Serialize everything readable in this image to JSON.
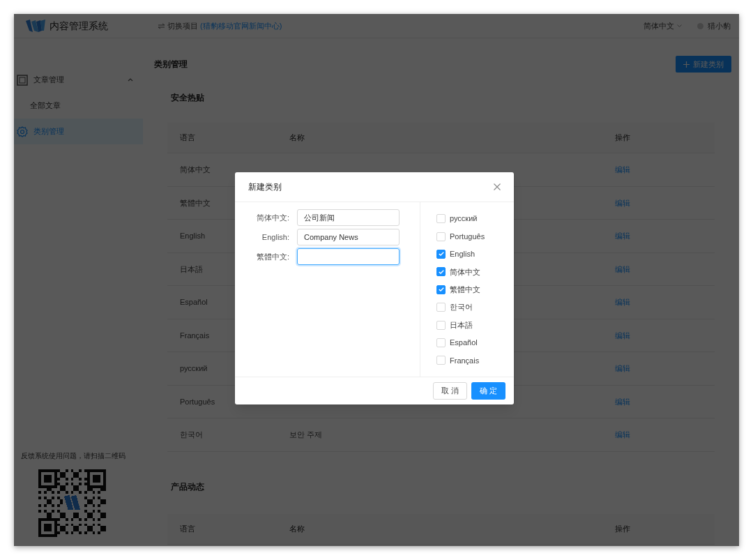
{
  "header": {
    "title": "内容管理系统",
    "switch_label": "切换项目",
    "project": "(猎豹移动官网新闻中心)",
    "language": "简体中文",
    "user": "猎小豹"
  },
  "sidebar": {
    "items": [
      {
        "label": "文章管理",
        "kind": "group",
        "selected": false,
        "expanded": true,
        "children": [
          {
            "label": "全部文章",
            "selected": false
          }
        ]
      },
      {
        "label": "类别管理",
        "kind": "link",
        "selected": true
      }
    ],
    "feedback": "反馈系统使用问题，请扫描二维码"
  },
  "page": {
    "title": "类别管理",
    "new_button": "新建类别"
  },
  "sections": [
    {
      "title": "安全热贴",
      "columns": [
        "语言",
        "名称",
        "操作"
      ],
      "rows": [
        {
          "language": "简体中文",
          "action": "编辑"
        },
        {
          "language": "繁體中文",
          "action": "编辑"
        },
        {
          "language": "English",
          "action": "编辑"
        },
        {
          "language": "日本語",
          "action": "编辑"
        },
        {
          "language": "Español",
          "action": "编辑"
        },
        {
          "language": "Français",
          "action": "编辑"
        },
        {
          "language": "русский",
          "action": "编辑"
        },
        {
          "language": "Português",
          "action": "编辑"
        },
        {
          "language": "한국어",
          "name": "보안 주제",
          "action": "编辑"
        }
      ]
    },
    {
      "title": "产品动态",
      "columns": [
        "语言",
        "名称",
        "操作"
      ]
    }
  ],
  "dialog": {
    "title": "新建类别",
    "fields": [
      {
        "label": "简体中文:",
        "value": "公司新闻",
        "focused": false
      },
      {
        "label": "English:",
        "value": "Company News",
        "focused": false
      },
      {
        "label": "繁體中文:",
        "focused": true
      }
    ],
    "languages": [
      {
        "label": "русский",
        "checked": false
      },
      {
        "label": "Português",
        "checked": false
      },
      {
        "label": "English",
        "checked": true
      },
      {
        "label": "简体中文",
        "checked": true
      },
      {
        "label": "繁體中文",
        "checked": true
      },
      {
        "label": "한국어",
        "checked": false
      },
      {
        "label": "日本語",
        "checked": false
      },
      {
        "label": "Español",
        "checked": false
      },
      {
        "label": "Français",
        "checked": false
      }
    ],
    "cancel": "取 消",
    "ok": "确 定"
  }
}
